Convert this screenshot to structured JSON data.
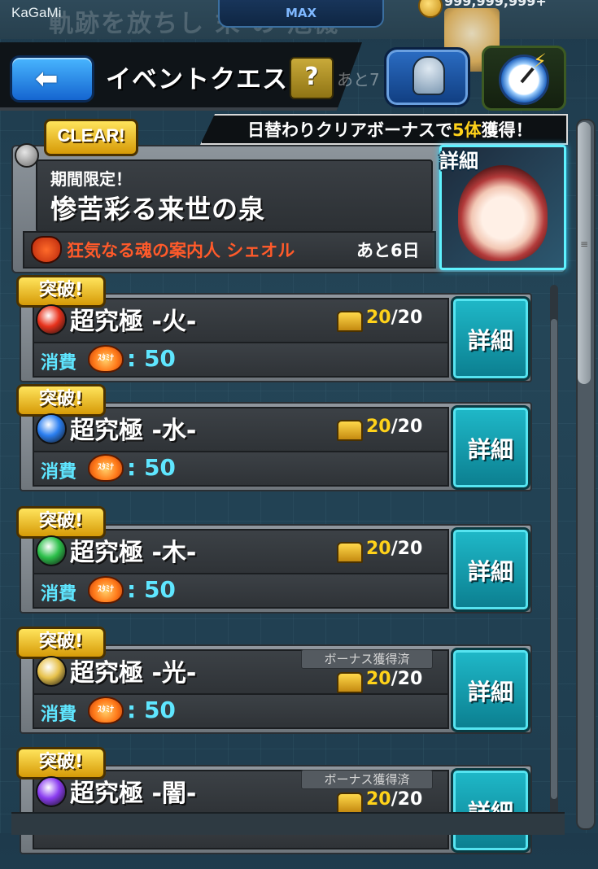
{
  "status": {
    "user": "KaGaMi",
    "max_label": "MAX",
    "banner_text": "軌跡を放ちし 末 の 危機",
    "coin_count": "999,999,999+"
  },
  "header": {
    "back_icon": "back-arrow-icon",
    "title": "イベントクエスト",
    "help_label": "?",
    "ato_label": "あと7",
    "bell_icon": "bell-icon",
    "stopwatch_icon": "stopwatch-icon"
  },
  "bonus_banner": {
    "prefix": "日替わりクリアボーナスで",
    "count": "5体",
    "suffix": "獲得！"
  },
  "event": {
    "clear_badge": "CLEAR!",
    "subtitle": "期間限定！",
    "title": "惨苦彩る来世の泉",
    "guide": "狂気なる魂の案内人 シェオル",
    "remaining": "あと6日",
    "detail_label": "詳細"
  },
  "quests": [
    {
      "badge": "突破!",
      "element": "fire",
      "element_color": "#e8321c",
      "title": "超究極 -火-",
      "bonus_done": "",
      "clear_current": "20",
      "clear_total": "/20",
      "cost_label": "消費",
      "stamina_text": "ｽﾀﾐﾅ",
      "cost": ": 50",
      "detail": "詳細"
    },
    {
      "badge": "突破!",
      "element": "water",
      "element_color": "#2a7ef0",
      "title": "超究極 -水-",
      "bonus_done": "",
      "clear_current": "20",
      "clear_total": "/20",
      "cost_label": "消費",
      "stamina_text": "ｽﾀﾐﾅ",
      "cost": ": 50",
      "detail": "詳細"
    },
    {
      "badge": "突破!",
      "element": "wood",
      "element_color": "#2cc04a",
      "title": "超究極 -木-",
      "bonus_done": "",
      "clear_current": "20",
      "clear_total": "/20",
      "cost_label": "消費",
      "stamina_text": "ｽﾀﾐﾅ",
      "cost": ": 50",
      "detail": "詳細"
    },
    {
      "badge": "突破!",
      "element": "light",
      "element_color": "#e7c14a",
      "title": "超究極 -光-",
      "bonus_done": "ボーナス獲得済",
      "clear_current": "20",
      "clear_total": "/20",
      "cost_label": "消費",
      "stamina_text": "ｽﾀﾐﾅ",
      "cost": ": 50",
      "detail": "詳細"
    },
    {
      "badge": "突破!",
      "element": "dark",
      "element_color": "#8a3cf0",
      "title": "超究極 -闇-",
      "bonus_done": "ボーナス獲得済",
      "clear_current": "20",
      "clear_total": "/20",
      "cost_label": "",
      "stamina_text": "",
      "cost": "",
      "detail": "詳細"
    }
  ]
}
